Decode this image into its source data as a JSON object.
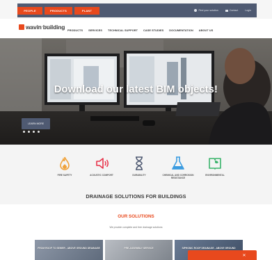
{
  "topbar": {
    "tabs": [
      "PEOPLE",
      "PRODUCTS",
      "PLANT"
    ],
    "links": [
      "Find your solution",
      "Contact",
      "Login"
    ]
  },
  "nav": {
    "logo_text": "wavin building",
    "logo_sub": "SOLUTIONS",
    "menu": [
      "PRODUCTS",
      "SERVICES",
      "TECHNICAL SUPPORT",
      "CASE STUDIES",
      "DOCUMENTATION",
      "ABOUT US"
    ]
  },
  "hero": {
    "title": "Download our latest BIM objects!",
    "button_label": "LEARN MORE",
    "slide_count": 4
  },
  "features": [
    {
      "icon": "fire-icon",
      "label": "FIRE SAFETY",
      "color": "#f0a23a"
    },
    {
      "icon": "acoustic-icon",
      "label": "ACOUSTIC COMFORT",
      "color": "#e8334a"
    },
    {
      "icon": "hourglass-icon",
      "label": "DURABILITY",
      "color": "#4f5a72"
    },
    {
      "icon": "flask-icon",
      "label": "CHEMICAL AND CORROSION RESISTANCE",
      "color": "#3a9be0"
    },
    {
      "icon": "leaf-book-icon",
      "label": "ENVIRONMENTAL",
      "color": "#39b36a"
    }
  ],
  "drainage_title": "DRAINAGE SOLUTIONS FOR BUILDINGS",
  "solutions": {
    "title": "OUR SOLUTIONS",
    "subtitle": "We provide complete and free drainage solutions",
    "cards": [
      {
        "label": "FROM ROOF TO SEWER - ABOVE GROUND DRAINAGE"
      },
      {
        "label": "PRE-ASSEMBLY SERVICE"
      },
      {
        "label": "SIPHONIC ROOF DRAINAGE - ABOVE GROUND"
      }
    ]
  },
  "colors": {
    "accent": "#e8491d",
    "navy": "#4f5a72"
  }
}
